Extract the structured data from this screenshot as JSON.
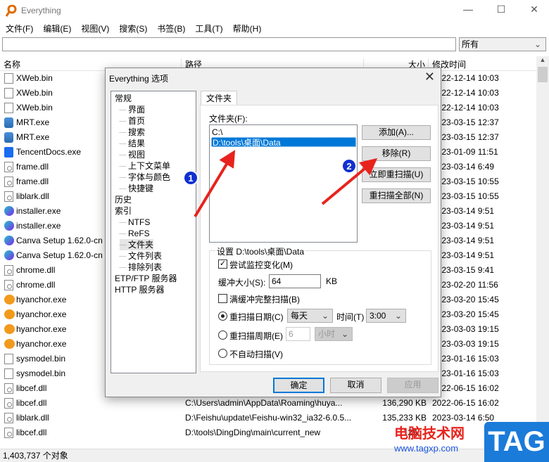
{
  "window": {
    "title": "Everything",
    "minimize": "—",
    "maximize": "☐",
    "close": "✕"
  },
  "menu": [
    "文件(F)",
    "编辑(E)",
    "视图(V)",
    "搜索(S)",
    "书签(B)",
    "工具(T)",
    "帮助(H)"
  ],
  "search": {
    "value": "",
    "filter": "所有"
  },
  "columns": {
    "name": "名称",
    "path": "路径",
    "size": "大小",
    "date": "修改时间"
  },
  "rows": [
    {
      "name": "XWeb.bin",
      "icon": "file-icon",
      "path": "",
      "size": "",
      "date": "2022-12-14 10:03"
    },
    {
      "name": "XWeb.bin",
      "icon": "file-icon",
      "path": "",
      "size": "",
      "date": "2022-12-14 10:03"
    },
    {
      "name": "XWeb.bin",
      "icon": "file-icon",
      "path": "",
      "size": "",
      "date": "2022-12-14 10:03"
    },
    {
      "name": "MRT.exe",
      "icon": "mrt-app-icon",
      "path": "",
      "size": "",
      "date": "2023-03-15 12:37"
    },
    {
      "name": "MRT.exe",
      "icon": "mrt-app-icon",
      "path": "",
      "size": "",
      "date": "2023-03-15 12:37"
    },
    {
      "name": "TencentDocs.exe",
      "icon": "tencent-docs-icon",
      "path": "",
      "size": "",
      "date": "2023-01-09 11:51"
    },
    {
      "name": "frame.dll",
      "icon": "dll-icon",
      "path": "",
      "size": "",
      "date": "2023-03-14 6:49"
    },
    {
      "name": "frame.dll",
      "icon": "dll-icon",
      "path": "",
      "size": "",
      "date": "2023-03-15 10:55"
    },
    {
      "name": "liblark.dll",
      "icon": "dll-icon",
      "path": "",
      "size": "",
      "date": "2023-03-15 10:55"
    },
    {
      "name": "installer.exe",
      "icon": "canva-icon",
      "path": "",
      "size": "",
      "date": "2023-03-14 9:51"
    },
    {
      "name": "installer.exe",
      "icon": "canva-icon",
      "path": "",
      "size": "",
      "date": "2023-03-14 9:51"
    },
    {
      "name": "Canva Setup 1.62.0-cn",
      "icon": "canva-icon",
      "path": "",
      "size": "",
      "date": "2023-03-14 9:51"
    },
    {
      "name": "Canva Setup 1.62.0-cn",
      "icon": "canva-icon",
      "path": "",
      "size": "",
      "date": "2023-03-14 9:51"
    },
    {
      "name": "chrome.dll",
      "icon": "dll-icon",
      "path": "",
      "size": "",
      "date": "2023-03-15 9:41"
    },
    {
      "name": "chrome.dll",
      "icon": "dll-icon",
      "path": "",
      "size": "",
      "date": "2023-02-20 11:56"
    },
    {
      "name": "hyanchor.exe",
      "icon": "huya-icon",
      "path": "",
      "size": "",
      "date": "2023-03-20 15:45"
    },
    {
      "name": "hyanchor.exe",
      "icon": "huya-icon",
      "path": "",
      "size": "",
      "date": "2023-03-20 15:45"
    },
    {
      "name": "hyanchor.exe",
      "icon": "huya-icon",
      "path": "",
      "size": "",
      "date": "2023-03-03 19:15"
    },
    {
      "name": "hyanchor.exe",
      "icon": "huya-icon",
      "path": "",
      "size": "",
      "date": "2023-03-03 19:15"
    },
    {
      "name": "sysmodel.bin",
      "icon": "file-icon",
      "path": "",
      "size": "",
      "date": "2023-01-16 15:03"
    },
    {
      "name": "sysmodel.bin",
      "icon": "file-icon",
      "path": "",
      "size": "",
      "date": "2023-01-16 15:03"
    },
    {
      "name": "libcef.dll",
      "icon": "dll-icon",
      "path": "",
      "size": "",
      "date": "2022-06-15 16:02"
    },
    {
      "name": "libcef.dll",
      "icon": "dll-icon",
      "path": "C:\\Users\\admin\\AppData\\Roaming\\huya...",
      "size": "136,290 KB",
      "date": "2022-06-15 16:02"
    },
    {
      "name": "liblark.dll",
      "icon": "dll-icon",
      "path": "D:\\Feishu\\update\\Feishu-win32_ia32-6.0.5...",
      "size": "135,233 KB",
      "date": "2023-03-14 6:50"
    },
    {
      "name": "libcef.dll",
      "icon": "dll-icon",
      "path": "D:\\tools\\DingDing\\main\\current_new",
      "size": "129,...",
      "date": ""
    }
  ],
  "status": "1,403,737 个对象",
  "dialog": {
    "title": "Everything 选项",
    "close": "✕",
    "tree": [
      {
        "label": "常规",
        "level": 0
      },
      {
        "label": "界面",
        "level": 1
      },
      {
        "label": "首页",
        "level": 1
      },
      {
        "label": "搜索",
        "level": 1
      },
      {
        "label": "结果",
        "level": 1
      },
      {
        "label": "视图",
        "level": 1
      },
      {
        "label": "上下文菜单",
        "level": 1
      },
      {
        "label": "字体与颜色",
        "level": 1
      },
      {
        "label": "快捷键",
        "level": 1
      },
      {
        "label": "历史",
        "level": 0
      },
      {
        "label": "索引",
        "level": 0
      },
      {
        "label": "NTFS",
        "level": 1
      },
      {
        "label": "ReFS",
        "level": 1
      },
      {
        "label": "文件夹",
        "level": 1,
        "selected": true
      },
      {
        "label": "文件列表",
        "level": 1
      },
      {
        "label": "排除列表",
        "level": 1
      },
      {
        "label": "ETP/FTP 服务器",
        "level": 0
      },
      {
        "label": "HTTP 服务器",
        "level": 0
      }
    ],
    "tab": "文件夹",
    "folders_label": "文件夹(F):",
    "folders": [
      "C:\\",
      "D:\\tools\\桌面\\Data"
    ],
    "selected_folder": 1,
    "buttons": {
      "add": "添加(A)...",
      "remove": "移除(R)",
      "rescan_now": "立即重扫描(U)",
      "rescan_all": "重扫描全部(N)"
    },
    "settings": {
      "legend": "设置 D:\\tools\\桌面\\Data",
      "monitor_label": "尝试监控变化(M)",
      "monitor_checked": true,
      "buffer_label": "缓冲大小(S):",
      "buffer_value": "64",
      "buffer_unit": "KB",
      "full_scan_label": "满缓冲完整扫描(B)",
      "full_scan_checked": false,
      "rescan_date_label": "重扫描日期(C)",
      "rescan_date_value": "每天",
      "time_label": "时间(T)",
      "time_value": "3:00",
      "rescan_period_label": "重扫描周期(E)",
      "period_value": "6",
      "period_unit": "小时",
      "no_auto_label": "不自动扫描(V)",
      "selected_mode": "rescan_date"
    },
    "ok": "确定",
    "cancel": "取消",
    "apply": "应用"
  },
  "annotations": {
    "badge1": "1",
    "badge2": "2",
    "arrow_color": "#e8231d",
    "badge_color": "#1030d0"
  },
  "watermark": {
    "site_name": "电脑技术网",
    "url": "www.tagxp.com",
    "logo": "TAG"
  }
}
